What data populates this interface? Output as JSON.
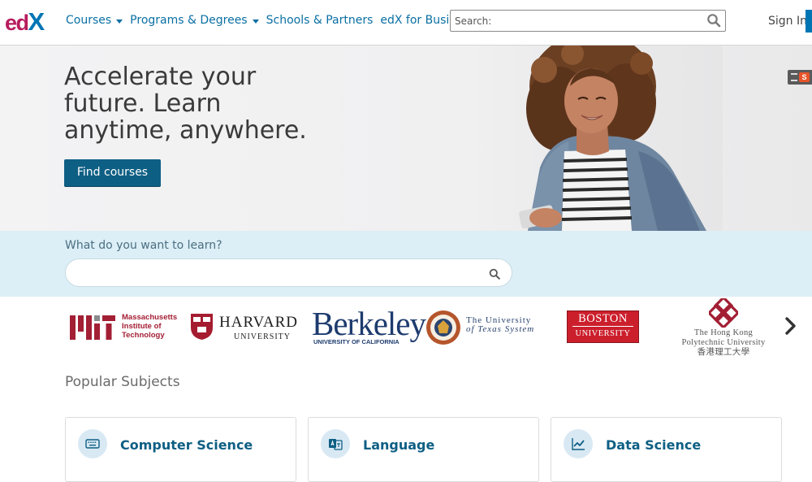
{
  "brand": {
    "logo_text_e": "e",
    "logo_text_d": "d",
    "logo_text_x": "X",
    "accent": "#0075b4",
    "logo_magenta": "#b71c5e"
  },
  "header": {
    "nav": [
      {
        "label": "Courses",
        "has_dropdown": true
      },
      {
        "label": "Programs & Degrees",
        "has_dropdown": true
      },
      {
        "label": "Schools & Partners",
        "has_dropdown": false
      },
      {
        "label": "edX for Business",
        "has_dropdown": false
      }
    ],
    "search": {
      "placeholder": "Search:",
      "value": "",
      "icon": "search-icon"
    },
    "sign_in": "Sign In"
  },
  "hero": {
    "title": "Accelerate your future. Learn anytime, anywhere.",
    "cta": "Find courses"
  },
  "learn_search": {
    "label": "What do you want to learn?",
    "placeholder": "",
    "value": "",
    "icon": "search-icon"
  },
  "partners": {
    "mit": {
      "abbrev": "MIT",
      "line1": "Massachusetts",
      "line2": "Institute of",
      "line3": "Technology",
      "color": "#a31f34"
    },
    "harvard": {
      "name": "HARVARD",
      "sub": "UNIVERSITY",
      "shield_text": "VE RI TAS"
    },
    "berkeley": {
      "name": "Berkeley",
      "sub": "UNIVERSITY OF CALIFORNIA",
      "color": "#1d3b6e"
    },
    "ut": {
      "line1": "The University",
      "line2": "of Texas System"
    },
    "bu": {
      "line1": "BOSTON",
      "line2": "UNIVERSITY",
      "color": "#cc1f2c"
    },
    "polyu": {
      "line1": "The Hong Kong",
      "line2": "Polytechnic University",
      "line3": "香港理工大學",
      "color": "#a31f34"
    },
    "next_icon": "chevron-right-icon"
  },
  "subjects": {
    "title": "Popular Subjects",
    "items": [
      {
        "label": "Computer Science",
        "icon": "keyboard-icon"
      },
      {
        "label": "Language",
        "icon": "translate-icon"
      },
      {
        "label": "Data Science",
        "icon": "line-chart-icon"
      }
    ]
  }
}
